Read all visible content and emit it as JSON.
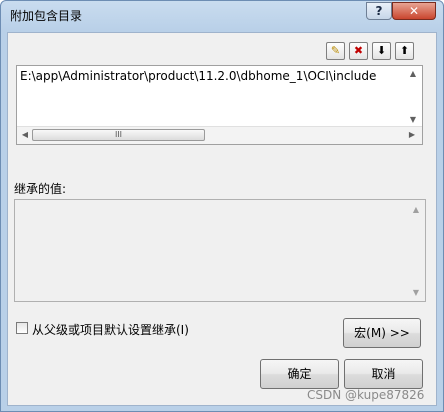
{
  "window": {
    "title": "附加包含目录",
    "help_label": "?",
    "close_label": "✕"
  },
  "toolbar": {
    "buttons": [
      {
        "name": "new-line-icon",
        "glyph": "✎"
      },
      {
        "name": "delete-icon",
        "glyph": "✖"
      },
      {
        "name": "move-down-icon",
        "glyph": "⬇"
      },
      {
        "name": "move-up-icon",
        "glyph": "⬆"
      }
    ]
  },
  "directories": {
    "items": [
      "E:\\app\\Administrator\\product\\11.2.0\\dbhome_1\\OCI\\include"
    ],
    "scroll_left": "◀",
    "scroll_right": "▶",
    "scroll_up": "▲",
    "scroll_down": "▼",
    "thumb_grip": "III"
  },
  "inherited": {
    "label": "继承的值:",
    "scroll_up": "▲",
    "scroll_down": "▼"
  },
  "inherit_option": {
    "label": "从父级或项目默认设置继承(I)",
    "checked": false
  },
  "buttons": {
    "macro": "宏(M) >>",
    "ok": "确定",
    "cancel": "取消"
  },
  "watermark": "CSDN @kupe87826"
}
